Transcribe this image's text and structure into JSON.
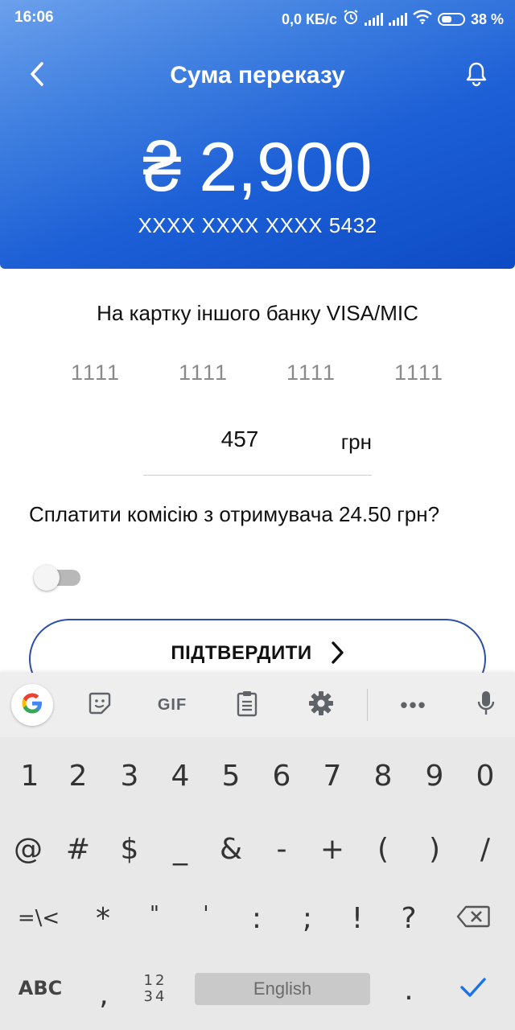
{
  "status_bar": {
    "time": "16:06",
    "network_speed": "0,0 КБ/с",
    "battery_percent": "38 %"
  },
  "header": {
    "title": "Сума переказу",
    "currency_symbol": "₴",
    "amount": "2,900",
    "card_mask": "XXXX XXXX XXXX 5432",
    "back_icon": "chevron-left-icon",
    "bell_icon": "bell-icon"
  },
  "form": {
    "destination_label": "На картку іншого банку VISA/MIC",
    "card_groups": [
      "1111",
      "1111",
      "1111",
      "1111"
    ],
    "sum_value": "457",
    "sum_currency": "грн",
    "commission_question": "Сплатити комісію з отримувача 24.50 грн?",
    "commission_toggle_on": false,
    "confirm_label": "ПІДТВЕРДИТИ"
  },
  "keyboard": {
    "toolbar_icons": [
      "google-icon",
      "sticker-icon",
      "gif-icon",
      "clipboard-icon",
      "gear-icon",
      "more-icon",
      "microphone-icon"
    ],
    "gif_label": "GIF",
    "more_label": "•••",
    "row1": [
      "1",
      "2",
      "3",
      "4",
      "5",
      "6",
      "7",
      "8",
      "9",
      "0"
    ],
    "row2": [
      "@",
      "#",
      "$",
      "_",
      "&",
      "-",
      "+",
      "(",
      ")",
      "/"
    ],
    "row3": [
      "=\\<",
      "*",
      "\"",
      "'",
      ":",
      ";",
      "!",
      "?"
    ],
    "abc_label": "ABC",
    "comma": ",",
    "numpad_top": "12",
    "numpad_bottom": "34",
    "space_label": "English",
    "period": ".",
    "accent_color": "#1a73e8"
  }
}
